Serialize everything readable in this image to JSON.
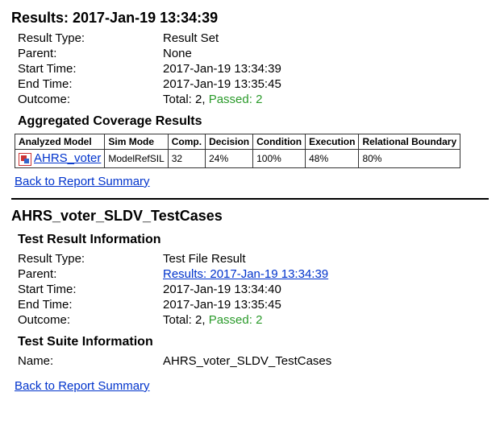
{
  "results": {
    "title": "Results: 2017-Jan-19 13:34:39",
    "result_type_label": "Result Type:",
    "result_type_value": "Result Set",
    "parent_label": "Parent:",
    "parent_value": "None",
    "start_label": "Start Time:",
    "start_value": "2017-Jan-19 13:34:39",
    "end_label": "End Time:",
    "end_value": "2017-Jan-19 13:35:45",
    "outcome_label": "Outcome:",
    "outcome_total": "Total: 2, ",
    "outcome_passed": "Passed: 2"
  },
  "coverage": {
    "heading": "Aggregated Coverage Results",
    "headers": {
      "model": "Analyzed Model",
      "sim": "Sim Mode",
      "comp": "Comp.",
      "decision": "Decision",
      "condition": "Condition",
      "execution": "Execution",
      "relational": "Relational Boundary"
    },
    "row": {
      "model_link": "AHRS_voter",
      "sim": "ModelRefSIL",
      "comp": "32",
      "decision": "24%",
      "condition": "100%",
      "execution": "48%",
      "relational": "80%"
    }
  },
  "back_link": "Back to Report Summary",
  "testcases": {
    "title": "AHRS_voter_SLDV_TestCases",
    "result_info_heading": "Test Result Information",
    "result_type_label": "Result Type:",
    "result_type_value": "Test File Result",
    "parent_label": "Parent:",
    "parent_link": "Results: 2017-Jan-19 13:34:39",
    "start_label": "Start Time:",
    "start_value": "2017-Jan-19 13:34:40",
    "end_label": "End Time:",
    "end_value": "2017-Jan-19 13:35:45",
    "outcome_label": "Outcome:",
    "outcome_total": "Total: 2, ",
    "outcome_passed": "Passed: 2",
    "suite_info_heading": "Test Suite Information",
    "name_label": "Name:",
    "name_value": "AHRS_voter_SLDV_TestCases"
  }
}
